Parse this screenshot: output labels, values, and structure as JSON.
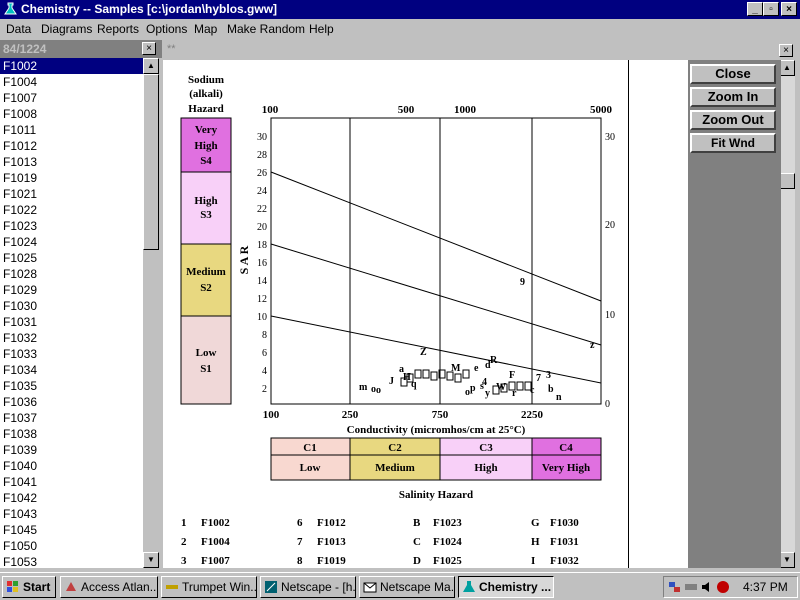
{
  "window": {
    "title": "Chemistry -- Samples [c:\\jordan\\hyblos.gww]",
    "controls": {
      "minimize": "_",
      "maximize": "▫",
      "close": "×"
    }
  },
  "menu": {
    "items": [
      "Data",
      "Diagrams",
      "Reports",
      "Options",
      "Map",
      "Make Random",
      "Help"
    ]
  },
  "sample_list": {
    "header": "84/1224",
    "selected": "F1002",
    "items": [
      "F1002",
      "F1004",
      "F1007",
      "F1008",
      "F1011",
      "F1012",
      "F1013",
      "F1019",
      "F1021",
      "F1022",
      "F1023",
      "F1024",
      "F1025",
      "F1028",
      "F1029",
      "F1030",
      "F1031",
      "F1032",
      "F1033",
      "F1034",
      "F1035",
      "F1036",
      "F1037",
      "F1038",
      "F1039",
      "F1040",
      "F1041",
      "F1042",
      "F1043",
      "F1045",
      "F1050",
      "F1053"
    ]
  },
  "diagram_window": {
    "label": "**"
  },
  "toolbar": {
    "close": "Close",
    "zoom_in": "Zoom In",
    "zoom_out": "Zoom Out",
    "fit_wnd": "Fit Wnd"
  },
  "diagram": {
    "sodium_title": [
      "Sodium",
      "(alkali)",
      "Hazard"
    ],
    "sodium_classes": [
      {
        "lines": [
          "Very",
          "High",
          "S4"
        ],
        "color": "#e070e0"
      },
      {
        "lines": [
          "High",
          "S3"
        ],
        "color": "#f8d0f8"
      },
      {
        "lines": [
          "Medium",
          "S2"
        ],
        "color": "#e8d880"
      },
      {
        "lines": [
          "Low",
          "S1"
        ],
        "color": "#f0d8d8"
      }
    ],
    "top_ticks": [
      "100",
      "500",
      "1000",
      "5000"
    ],
    "y_axis_label": "S A R",
    "left_ticks": [
      "30",
      "28",
      "26",
      "24",
      "22",
      "20",
      "18",
      "16",
      "14",
      "12",
      "10",
      "8",
      "6",
      "4",
      "2"
    ],
    "right_ticks": [
      "30",
      "20",
      "10",
      "0"
    ],
    "bottom_ticks": [
      "100",
      "250",
      "750",
      "2250"
    ],
    "x_axis_label": "Conductivity (micromhos/cm at 25°C)",
    "salinity_classes": [
      {
        "code": "C1",
        "name": "Low",
        "color": "#f8d8d0"
      },
      {
        "code": "C2",
        "name": "Medium",
        "color": "#e8d880"
      },
      {
        "code": "C3",
        "name": "High",
        "color": "#f8d0f8"
      },
      {
        "code": "C4",
        "name": "Very High",
        "color": "#e070e0"
      }
    ],
    "salinity_title": "Salinity Hazard",
    "point_symbols": [
      "m",
      "o",
      "o",
      "J",
      "H",
      "a",
      "q",
      "9",
      "z",
      "R",
      "d",
      "e",
      "M",
      "Z",
      "F",
      "7",
      "3",
      "b",
      "n",
      "4",
      "y",
      "s",
      "p",
      "o",
      "W",
      "r",
      "c"
    ],
    "legend_rows": [
      [
        [
          "1",
          "F1002"
        ],
        [
          "6",
          "F1012"
        ],
        [
          "B",
          "F1023"
        ],
        [
          "G",
          "F1030"
        ]
      ],
      [
        [
          "2",
          "F1004"
        ],
        [
          "7",
          "F1013"
        ],
        [
          "C",
          "F1024"
        ],
        [
          "H",
          "F1031"
        ]
      ],
      [
        [
          "3",
          "F1007"
        ],
        [
          "8",
          "F1019"
        ],
        [
          "D",
          "F1025"
        ],
        [
          "I",
          "F1032"
        ]
      ]
    ]
  },
  "taskbar": {
    "start": "Start",
    "tasks": [
      "Access Atlan...",
      "Trumpet Win...",
      "Netscape - [h...",
      "Netscape Ma...",
      "Chemistry ..."
    ],
    "active_task": 4,
    "clock": "4:37 PM"
  }
}
